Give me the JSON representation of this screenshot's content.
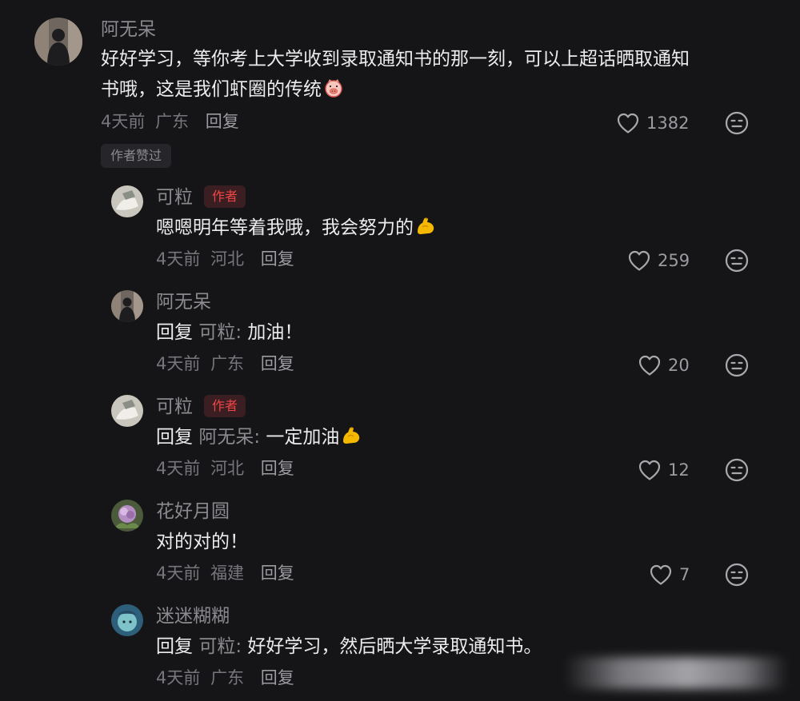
{
  "comments": [
    {
      "user": "阿无呆",
      "text": "好好学习，等你考上大学收到录取通知书的那一刻，可以上超话晒取通知",
      "text2": "书哦，这是我们虾圈的传统",
      "time": "4天前",
      "location": "广东",
      "reply_label": "回复",
      "likes": "1382",
      "liked_by_author": "作者赞过"
    },
    {
      "user": "可粒",
      "badge": "作者",
      "text": "嗯嗯明年等着我哦，我会努力的",
      "time": "4天前",
      "location": "河北",
      "reply_label": "回复",
      "likes": "259"
    },
    {
      "user": "阿无呆",
      "prefix": "回复",
      "ref": "可粒:",
      "text": "加油！",
      "time": "4天前",
      "location": "广东",
      "reply_label": "回复",
      "likes": "20"
    },
    {
      "user": "可粒",
      "badge": "作者",
      "prefix": "回复",
      "ref": "阿无呆:",
      "text": "一定加油",
      "time": "4天前",
      "location": "河北",
      "reply_label": "回复",
      "likes": "12"
    },
    {
      "user": "花好月圆",
      "text": "对的对的！",
      "time": "4天前",
      "location": "福建",
      "reply_label": "回复",
      "likes": "7"
    },
    {
      "user": "迷迷糊糊",
      "prefix": "回复",
      "ref": "可粒:",
      "text": "好好学习，然后晒大学录取通知书。",
      "time": "4天前",
      "location": "广东",
      "reply_label": "回复"
    }
  ],
  "icons": {
    "like": "heart-outline-icon",
    "dislike": "meh-face-icon",
    "emoji_peach": "pig-face-emoji",
    "emoji_muscle": "flexed-biceps-emoji"
  },
  "colors": {
    "background": "#151517",
    "author_badge": "#f04545",
    "text": "#ececee",
    "muted": "#8a8a8f"
  }
}
